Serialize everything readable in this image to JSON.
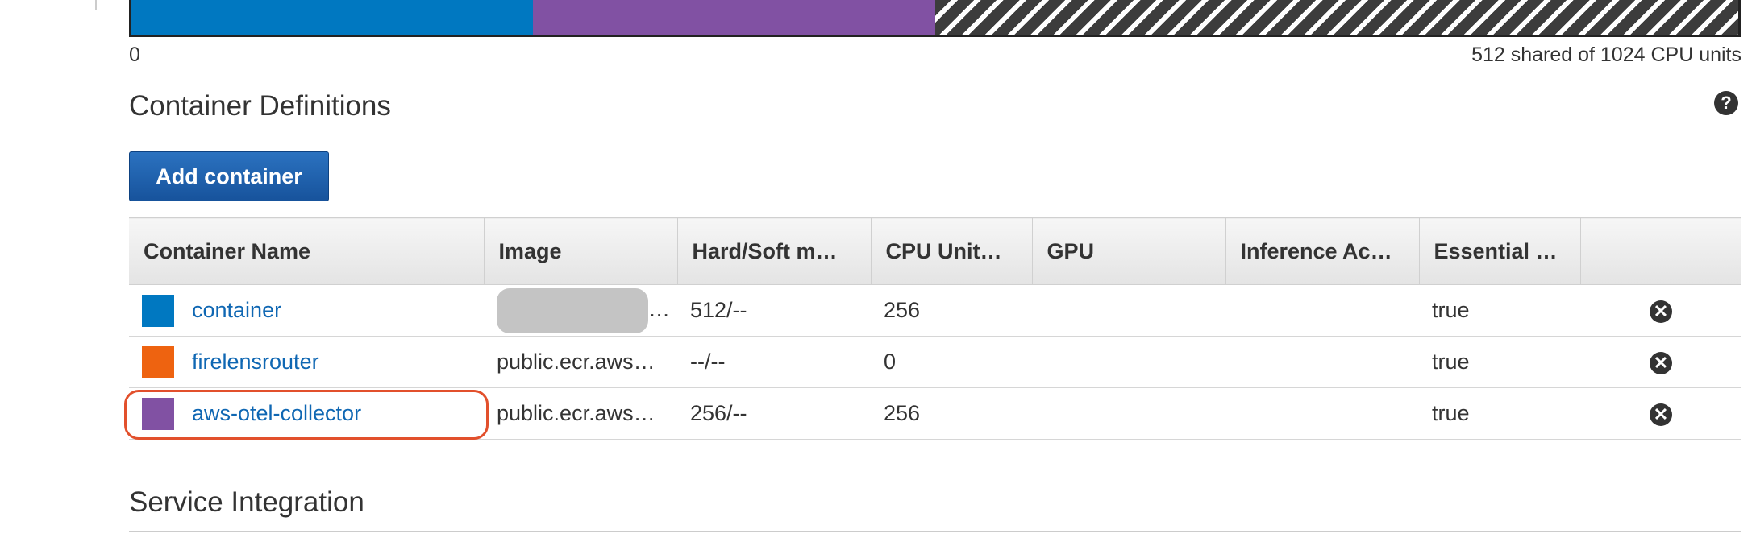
{
  "cpu": {
    "min_label": "0",
    "max_label": "512 shared of 1024 CPU units",
    "segments": [
      {
        "name": "container",
        "fraction": 0.25,
        "color": "#0078c1"
      },
      {
        "name": "aws-otel-collector",
        "fraction": 0.25,
        "color": "#8151a3"
      }
    ]
  },
  "container_definitions": {
    "title": "Container Definitions",
    "help": "?",
    "add_button": "Add container",
    "columns": [
      "Container Name",
      "Image",
      "Hard/Soft m…",
      "CPU Unit…",
      "GPU",
      "Inference Ac…",
      "Essential …",
      ""
    ],
    "rows": [
      {
        "name": "container",
        "color": "#0078c1",
        "image": "…",
        "memory": "512/--",
        "cpu": "256",
        "gpu": "",
        "inference": "",
        "essential": "true",
        "remove": "✕"
      },
      {
        "name": "firelensrouter",
        "color": "#ee6310",
        "image": "public.ecr.aws…",
        "memory": "--/--",
        "cpu": "0",
        "gpu": "",
        "inference": "",
        "essential": "true",
        "remove": "✕"
      },
      {
        "name": "aws-otel-collector",
        "color": "#8151a3",
        "image": "public.ecr.aws…",
        "memory": "256/--",
        "cpu": "256",
        "gpu": "",
        "inference": "",
        "essential": "true",
        "remove": "✕"
      }
    ]
  },
  "service_integration": {
    "title": "Service Integration"
  }
}
